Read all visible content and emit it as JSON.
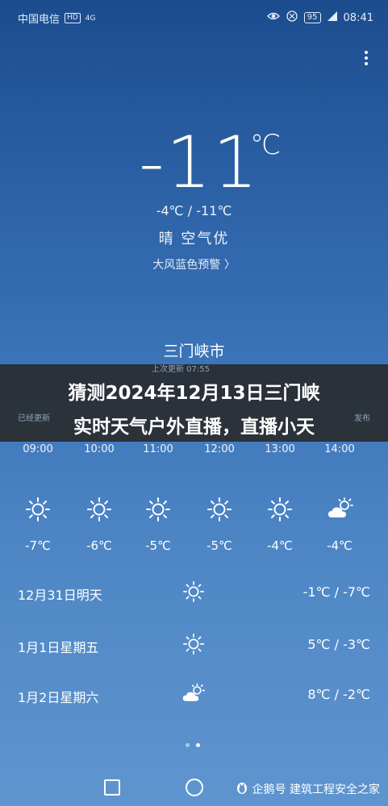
{
  "status_bar": {
    "carrier": "中国电信",
    "hd": "HD",
    "network": "4G",
    "battery": "95",
    "time": "08:41",
    "icons": [
      "eye-icon",
      "alarm-icon",
      "battery-icon",
      "signal-icon"
    ]
  },
  "current": {
    "temperature": "-11",
    "unit": "℃",
    "range": "-4℃ / -11℃",
    "condition": "晴  空气优",
    "warning": "大风蓝色预警 〉",
    "city": "三门峡市"
  },
  "banner": {
    "line1": "猜测2024年12月13日三门峡",
    "line2": "实时天气户外直播，直播小天",
    "ghost_left": "已经更新",
    "ghost_center": "上次更新 07:55",
    "ghost_right": "发布"
  },
  "hourly": [
    {
      "time": "09:00",
      "icon": "sun-icon",
      "temp": "-7℃"
    },
    {
      "time": "10:00",
      "icon": "sun-icon",
      "temp": "-6℃"
    },
    {
      "time": "11:00",
      "icon": "sun-icon",
      "temp": "-5℃"
    },
    {
      "time": "12:00",
      "icon": "sun-icon",
      "temp": "-5℃"
    },
    {
      "time": "13:00",
      "icon": "sun-icon",
      "temp": "-4℃"
    },
    {
      "time": "14:00",
      "icon": "partly-cloudy-icon",
      "temp": "-4℃"
    }
  ],
  "daily": [
    {
      "day": "12月31日明天",
      "icon": "sun-icon",
      "temps": "-1℃ / -7℃"
    },
    {
      "day": "1月1日星期五",
      "icon": "sun-icon",
      "temps": "5℃ / -3℃"
    },
    {
      "day": "1月2日星期六",
      "icon": "partly-cloudy-icon",
      "temps": "8℃ / -2℃"
    }
  ],
  "watermark": "企鹅号 建筑工程安全之家"
}
